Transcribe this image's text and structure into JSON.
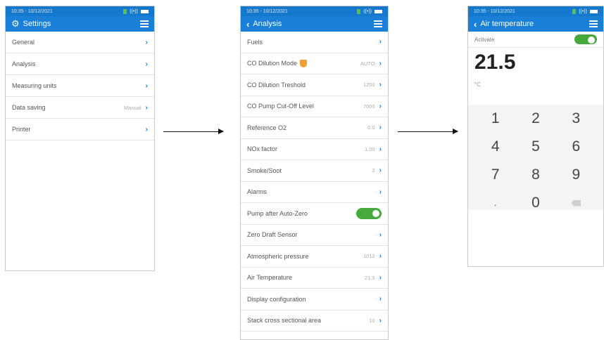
{
  "status": {
    "time_date": "10:35 - 10/12/2021"
  },
  "screen1": {
    "title": "Settings",
    "items": [
      {
        "label": "General",
        "value": ""
      },
      {
        "label": "Analysis",
        "value": ""
      },
      {
        "label": "Measuring units",
        "value": ""
      },
      {
        "label": "Data saving",
        "value": "Manual"
      },
      {
        "label": "Printer",
        "value": ""
      }
    ]
  },
  "screen2": {
    "title": "Analysis",
    "items": [
      {
        "label": "Fuels",
        "value": ""
      },
      {
        "label": "CO Dilution Mode",
        "value": "AUTO"
      },
      {
        "label": "CO Dilution Treshold",
        "value": "1200"
      },
      {
        "label": "CO Pump Cut-Off Level",
        "value": "7000"
      },
      {
        "label": "Reference O2",
        "value": "0.0"
      },
      {
        "label": "NOx factor",
        "value": "1.00"
      },
      {
        "label": "Smoke/Soot",
        "value": "2"
      },
      {
        "label": "Alarms",
        "value": ""
      },
      {
        "label": "Pump after Auto-Zero",
        "value": ""
      },
      {
        "label": "Zero Draft Sensor",
        "value": ""
      },
      {
        "label": "Atmospheric pressure",
        "value": "1012"
      },
      {
        "label": "Air Temperature",
        "value": "21.5"
      },
      {
        "label": "Display configuration",
        "value": ""
      },
      {
        "label": "Stack cross sectional area",
        "value": "10"
      }
    ],
    "pump_toggle_on": true
  },
  "screen3": {
    "title": "Air temperature",
    "activate_label": "Activate",
    "activate_on": true,
    "value": "21.5",
    "unit": "°C",
    "keys": [
      "1",
      "2",
      "3",
      "4",
      "5",
      "6",
      "7",
      "8",
      "9",
      ".",
      "0",
      ""
    ]
  },
  "colors": {
    "header": "#1a7fd6",
    "accent_blue": "#1a7fd6",
    "toggle_green": "#47a83c"
  }
}
